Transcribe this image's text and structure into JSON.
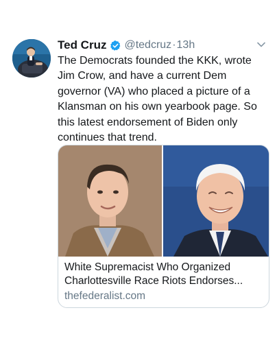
{
  "tweet": {
    "author_name": "Ted Cruz",
    "handle": "@tedcruz",
    "separator": "·",
    "time": "13h",
    "text": "The Democrats founded the KKK, wrote Jim Crow, and have a current Dem governor (VA) who placed a picture of a Klansman on his own yearbook page. So this latest endorsement of Biden only continues that trend."
  },
  "card": {
    "title": "White Supremacist Who Organized Charlottesville Race Riots Endorses...",
    "domain": "thefederalist.com"
  },
  "icons": {
    "verified": "verified-badge-icon",
    "menu": "chevron-down-icon"
  },
  "colors": {
    "verified_blue": "#1da1f2",
    "secondary_text": "#657786",
    "card_border": "#ccd6dd"
  }
}
